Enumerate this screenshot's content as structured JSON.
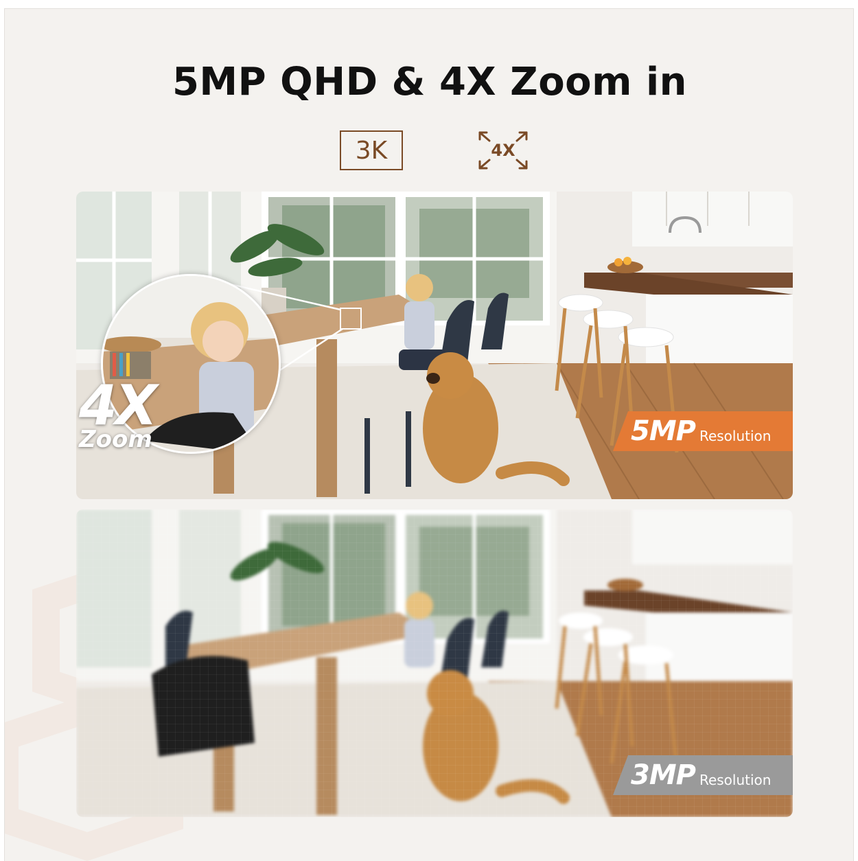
{
  "header": {
    "title": "5MP QHD & 4X Zoom in"
  },
  "badges": {
    "resolution_badge": "3K",
    "zoom_badge": "4X"
  },
  "top_panel": {
    "zoom_inset": {
      "big": "4X",
      "small": "Zoom"
    },
    "label": {
      "big": "5MP",
      "small": "Resolution"
    }
  },
  "bottom_panel": {
    "label": {
      "big": "3MP",
      "small": "Resolution"
    }
  },
  "colors": {
    "accent_brown": "#7a4a26",
    "label_orange": "#e47a35",
    "label_grey": "#9a9a9a",
    "background": "#f4f2ef"
  },
  "icons": [
    "expand-arrows-icon"
  ]
}
